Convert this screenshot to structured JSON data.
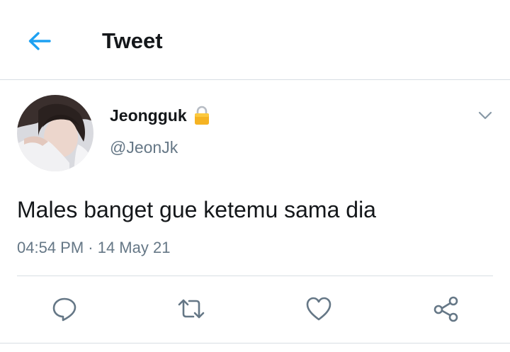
{
  "header": {
    "title": "Tweet",
    "back_icon": "arrow-left-icon",
    "accent_color": "#1da1f2"
  },
  "tweet": {
    "author_name": "Jeongguk",
    "author_handle": "@JeonJk",
    "protected_icon": "lock-icon",
    "text": "Males banget gue ketemu sama dia",
    "timestamp": "04:54 PM · 14 May 21"
  },
  "actions": [
    {
      "name": "reply",
      "icon": "reply-icon"
    },
    {
      "name": "retweet",
      "icon": "retweet-icon"
    },
    {
      "name": "like",
      "icon": "heart-icon"
    },
    {
      "name": "share",
      "icon": "share-icon"
    }
  ],
  "colors": {
    "text": "#14171a",
    "secondary": "#657786",
    "divider": "#d8dee3",
    "icon": "#657786"
  }
}
